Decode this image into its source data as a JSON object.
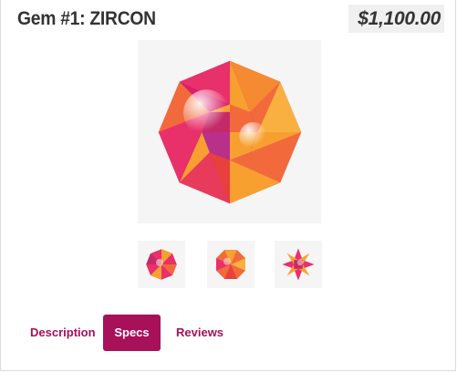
{
  "product": {
    "title": "Gem #1: ZIRCON",
    "price": "$1,100.00"
  },
  "images": {
    "main": {
      "icon": "gem-star-icon"
    },
    "thumbnails": [
      {
        "icon": "gem-thumbnail-1-icon"
      },
      {
        "icon": "gem-thumbnail-2-icon"
      },
      {
        "icon": "gem-thumbnail-3-icon"
      }
    ]
  },
  "tabs": [
    {
      "label": "Description",
      "active": false
    },
    {
      "label": "Specs",
      "active": true
    },
    {
      "label": "Reviews",
      "active": false
    }
  ],
  "colors": {
    "accent": "#a8105a",
    "gem_pink": "#e8306a",
    "gem_orange": "#f7a030",
    "gem_red": "#e8403a"
  }
}
